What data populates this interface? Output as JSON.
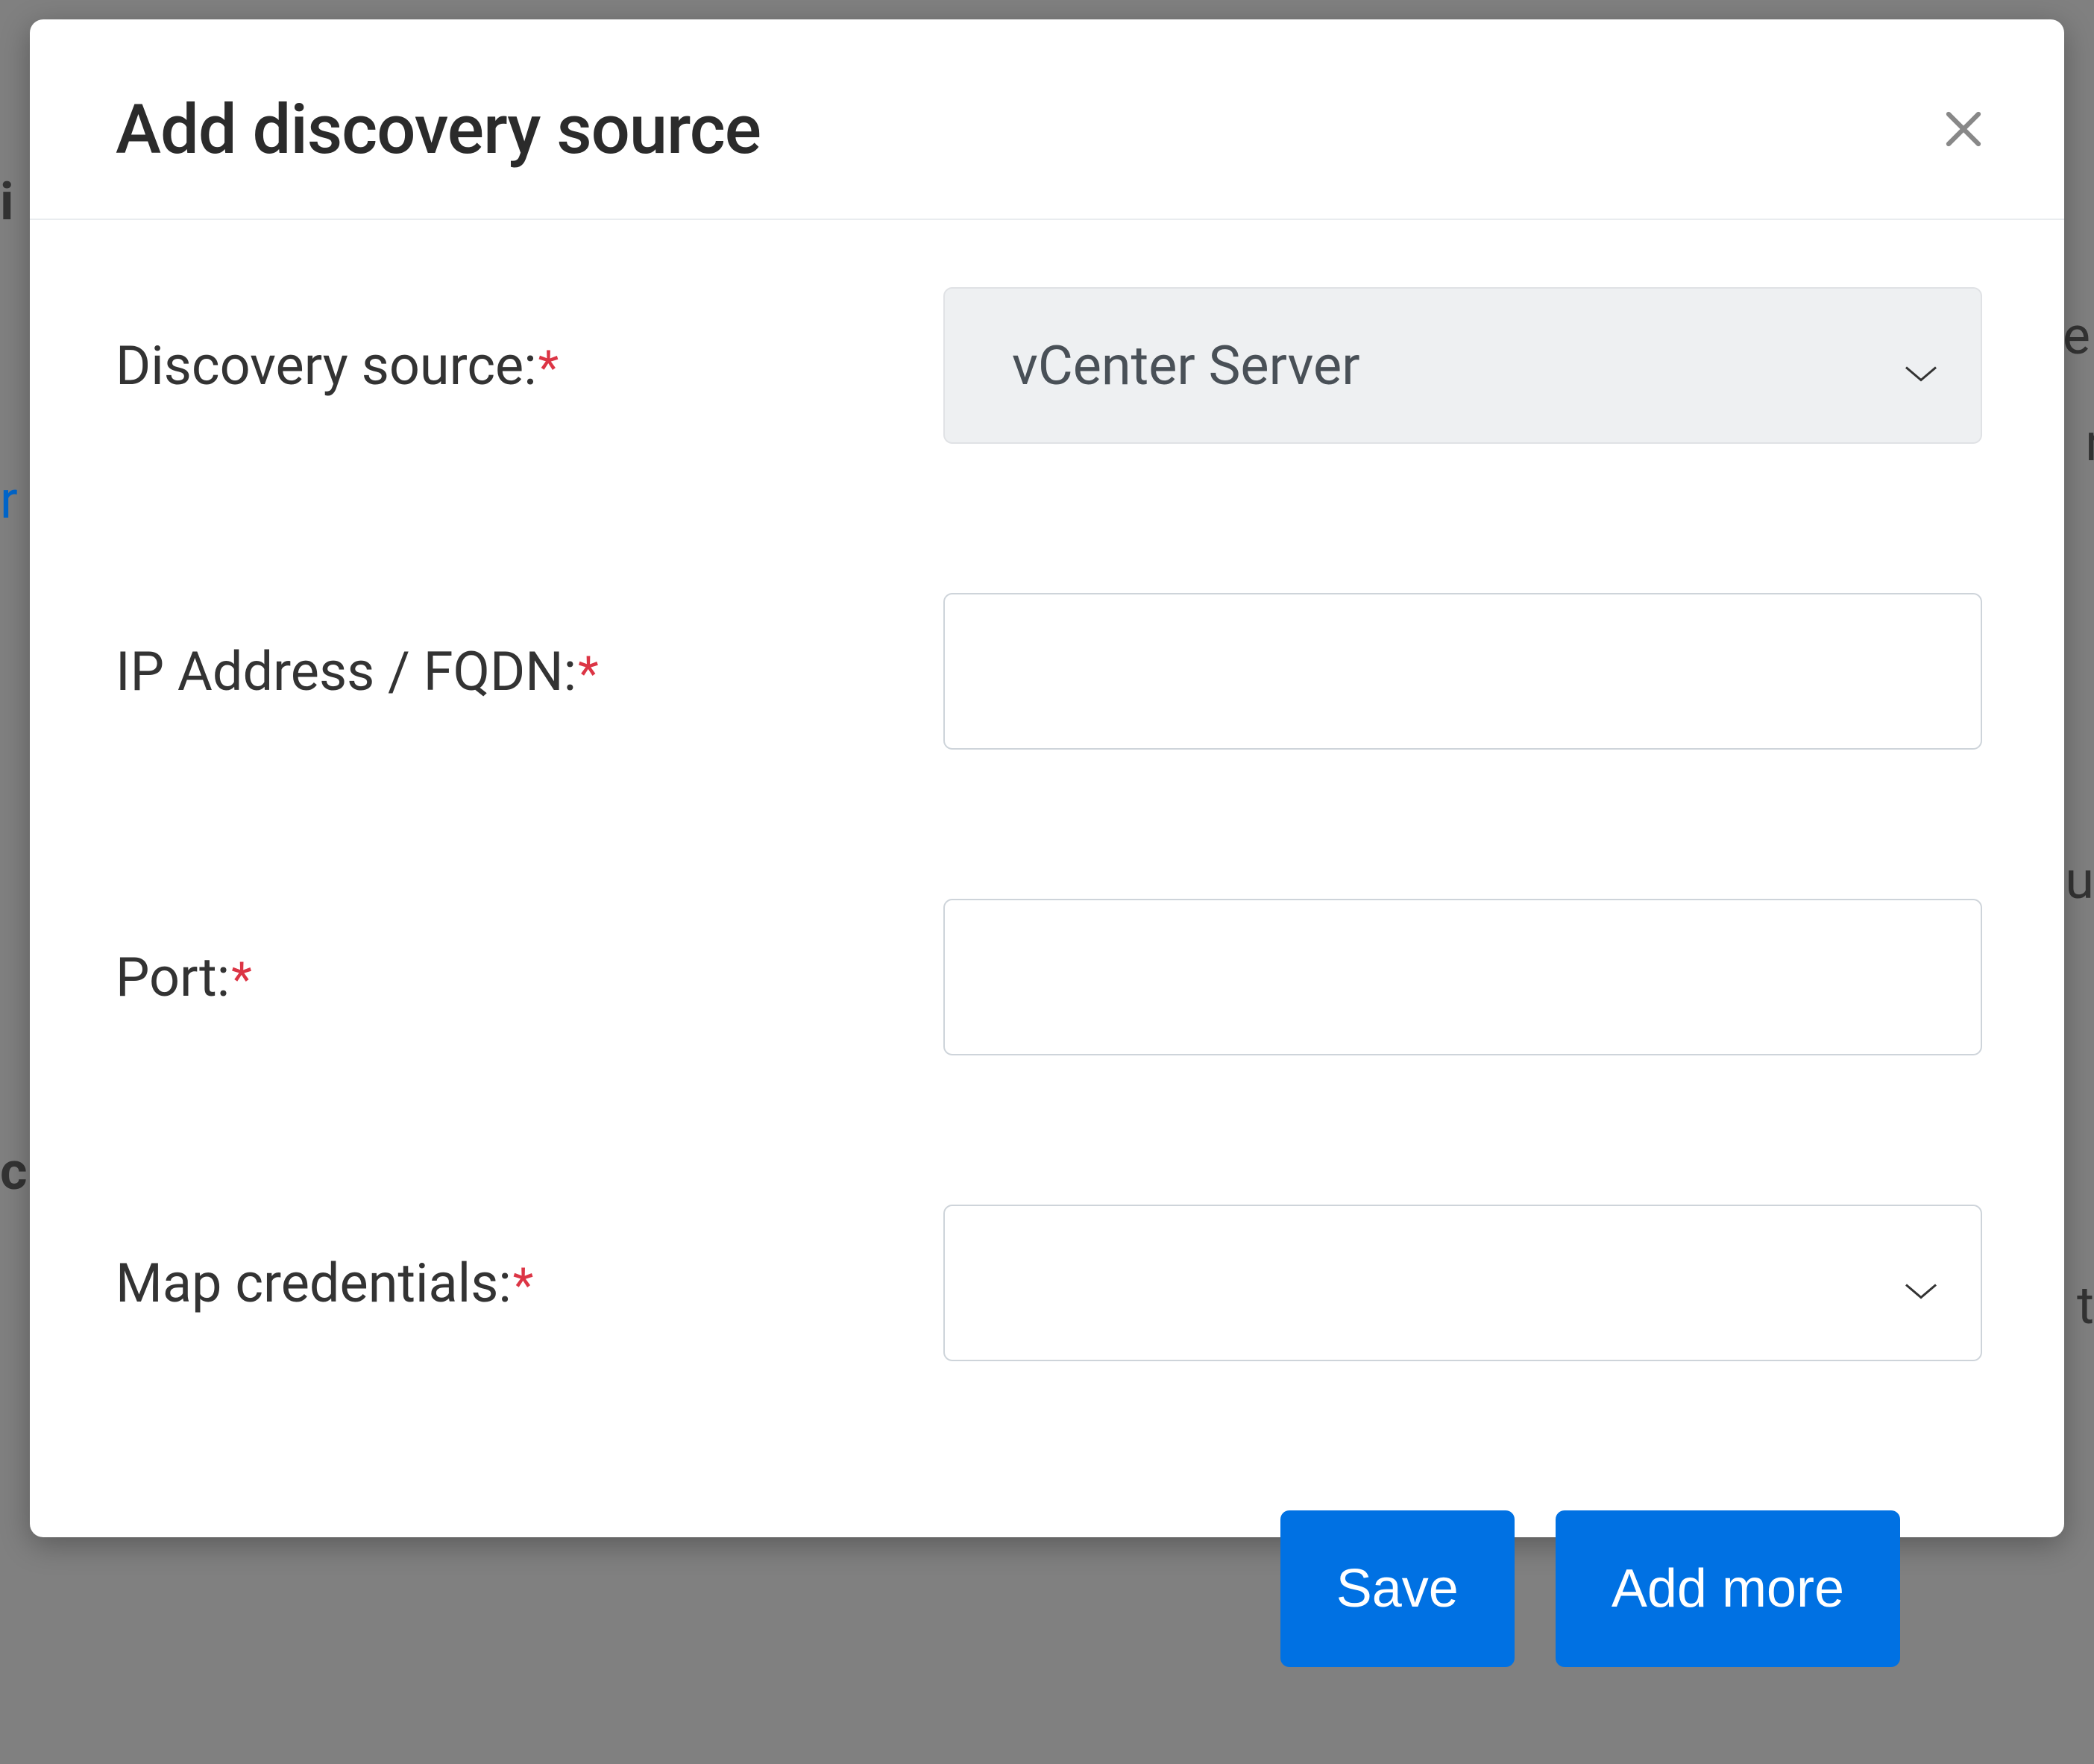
{
  "modal": {
    "title": "Add discovery source",
    "fields": {
      "discovery_source": {
        "label": "Discovery source:",
        "value": "vCenter Server"
      },
      "ip_fqdn": {
        "label": "IP Address / FQDN:",
        "value": ""
      },
      "port": {
        "label": "Port:",
        "value": ""
      },
      "map_credentials": {
        "label": "Map credentials:",
        "value": ""
      }
    },
    "required_marker": "*",
    "buttons": {
      "save": "Save",
      "add_more": "Add more"
    }
  },
  "backdrop": {
    "frag1": "i",
    "frag2": "e",
    "frag3": "r",
    "frag4": "r",
    "frag5": "u",
    "frag6": "c",
    "frag7": "t"
  }
}
